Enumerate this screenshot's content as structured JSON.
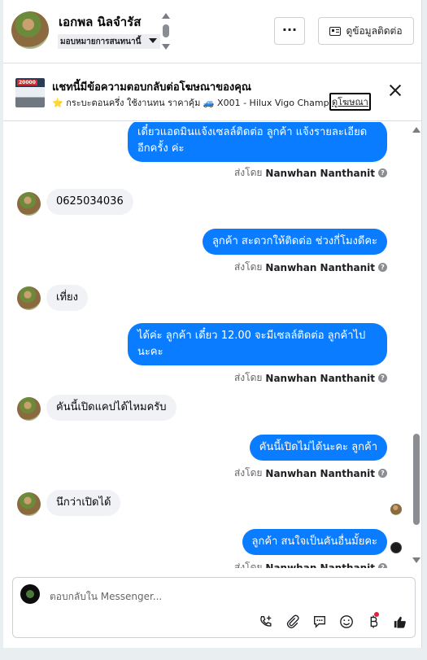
{
  "header": {
    "contact_name": "เอกพล นิลจำรัส",
    "assign_label": "มอบหมายการสนทนานี้",
    "more_label": "···",
    "contact_info_label": "ดูข้อมูลติดต่อ"
  },
  "ad_banner": {
    "thumb_price": "20000",
    "title": "แชทนี้มีข้อความตอบกลับต่อโฆษณาของคุณ",
    "subtitle": "⭐ กระบะตอนครึ่ง ใช้งานทน ราคาคุ้ม 🚙 X001 - Hilux Vigo Champ Cab...",
    "link_label": "ดูโฆษณา"
  },
  "conversation": {
    "sent_prefix": "ส่งโดย",
    "sender_name": "Nanwhan Nanthanit",
    "messages": [
      {
        "dir": "out",
        "text": "เดี๋ยวแอดมินแจ้งเซลล์ติดต่อ ลูกค้า แจ้งรายละเอียดอีกครั้ง ค่ะ"
      },
      {
        "dir": "in",
        "text": "0625034036"
      },
      {
        "dir": "out",
        "text": "ลูกค้า สะดวกให้ติดต่อ ช่วงกี่โมงดีคะ"
      },
      {
        "dir": "in",
        "text": "เที่ยง"
      },
      {
        "dir": "out",
        "text": "ได้ค่ะ  ลูกค้า เดี๋ยว  12.00 จะมีเซลล์ติดต่อ ลูกค้าไปนะคะ"
      },
      {
        "dir": "in",
        "text": "คันนี้เปิดแคปได้ไหมครับ"
      },
      {
        "dir": "out",
        "text": "คันนี้เปิดไม่ได้นะคะ  ลูกค้า"
      },
      {
        "dir": "in",
        "text": "นึกว่าเปิดได้"
      },
      {
        "dir": "out",
        "text": "ลูกค้า สนใจเป็นคันอื่นมั้ยคะ"
      }
    ]
  },
  "composer": {
    "placeholder": "ตอบกลับใน Messenger..."
  }
}
